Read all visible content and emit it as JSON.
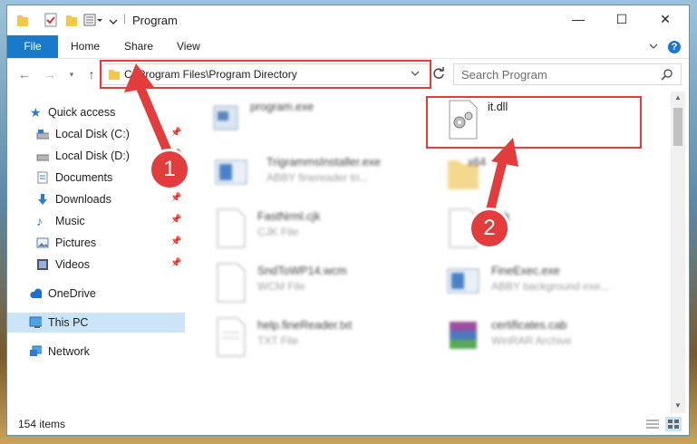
{
  "window": {
    "title": "Program",
    "minimize_glyph": "—",
    "maximize_glyph": "☐",
    "close_glyph": "✕"
  },
  "ribbon": {
    "tabs": [
      {
        "label": "File"
      },
      {
        "label": "Home"
      },
      {
        "label": "Share"
      },
      {
        "label": "View"
      }
    ],
    "help_glyph": "?"
  },
  "navigation": {
    "address": "C:\\Program Files\\Program Directory",
    "search_placeholder": "Search Program"
  },
  "sidebar": {
    "items": [
      {
        "label": "Quick access",
        "icon": "star-icon",
        "pinned": false
      },
      {
        "label": "Local Disk (C:)",
        "icon": "drive-icon",
        "pinned": true
      },
      {
        "label": "Local Disk (D:)",
        "icon": "drive-icon",
        "pinned": true
      },
      {
        "label": "Documents",
        "icon": "documents-icon",
        "pinned": true
      },
      {
        "label": "Downloads",
        "icon": "download-icon",
        "pinned": true
      },
      {
        "label": "Music",
        "icon": "music-icon",
        "pinned": true
      },
      {
        "label": "Pictures",
        "icon": "pictures-icon",
        "pinned": true
      },
      {
        "label": "Videos",
        "icon": "videos-icon",
        "pinned": true
      },
      {
        "label": "OneDrive",
        "icon": "cloud-icon",
        "pinned": false
      },
      {
        "label": "This PC",
        "icon": "computer-icon",
        "pinned": false
      },
      {
        "label": "Network",
        "icon": "network-icon",
        "pinned": false
      }
    ]
  },
  "files": [
    {
      "name": "program.exe",
      "type": ""
    },
    {
      "name": "it.dll",
      "type": ""
    },
    {
      "name": "TrigrammsInstaller.exe",
      "type": "ABBY finereader tri..."
    },
    {
      "name": "x64",
      "type": ""
    },
    {
      "name": "FastNrml.cjk",
      "type": "CJK File"
    },
    {
      "name": "...k",
      "type": ""
    },
    {
      "name": "SndToWP14.wcm",
      "type": "WCM File"
    },
    {
      "name": "FineExec.exe",
      "type": "ABBY background exe..."
    },
    {
      "name": "help.fineReader.txt",
      "type": "TXT File"
    },
    {
      "name": "certificates.cab",
      "type": "WinRAR Archive"
    }
  ],
  "status": {
    "item_count": "154 items"
  },
  "callouts": [
    "1",
    "2"
  ],
  "colors": {
    "accent": "#1979ca",
    "highlight": "#e23c3c",
    "selection": "#cce4f7"
  }
}
